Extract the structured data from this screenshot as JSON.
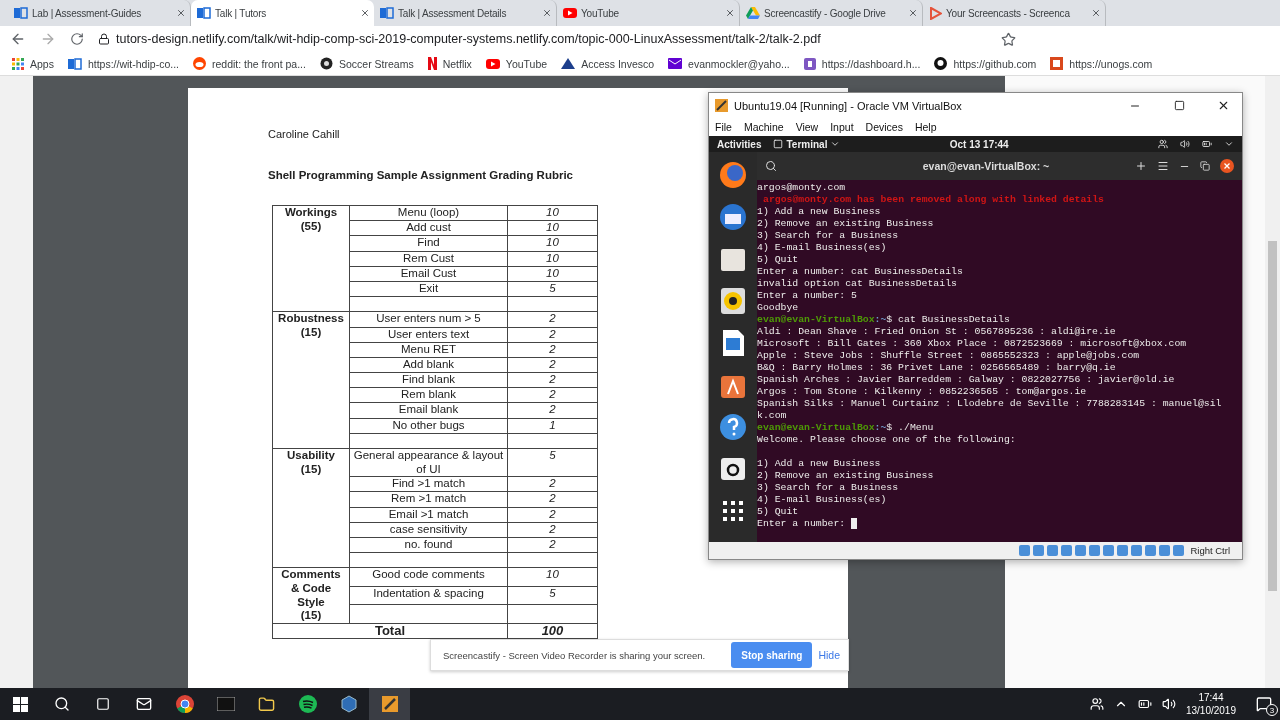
{
  "browser": {
    "tabs": [
      {
        "title": "Lab | Assessment-Guides",
        "kind": "tutors",
        "selected": false
      },
      {
        "title": "Talk | Tutors",
        "kind": "tutors",
        "selected": true
      },
      {
        "title": "Talk | Assessment Details",
        "kind": "tutors",
        "selected": false
      },
      {
        "title": "YouTube",
        "kind": "youtube",
        "selected": false
      },
      {
        "title": "Screencastify - Google Drive",
        "kind": "drive",
        "selected": false
      },
      {
        "title": "Your Screencasts - Screenca",
        "kind": "screencastify",
        "selected": false
      }
    ],
    "url": "tutors-design.netlify.com/talk/wit-hdip-comp-sci-2019-computer-systems.netlify.com/topic-000-LinuxAssessment/talk-2/talk-2.pdf",
    "bookmarks": [
      {
        "label": "Apps",
        "kind": "apps"
      },
      {
        "label": "https://wit-hdip-co...",
        "kind": "tutors"
      },
      {
        "label": "reddit: the front pa...",
        "kind": "reddit"
      },
      {
        "label": "Soccer Streams",
        "kind": "ball"
      },
      {
        "label": "Netflix",
        "kind": "netflix"
      },
      {
        "label": "YouTube",
        "kind": "youtube"
      },
      {
        "label": "Access Invesco",
        "kind": "invesco"
      },
      {
        "label": "evanmockler@yaho...",
        "kind": "mail"
      },
      {
        "label": "https://dashboard.h...",
        "kind": "dashboard"
      },
      {
        "label": "https://github.com",
        "kind": "github"
      },
      {
        "label": "https://unogs.com",
        "kind": "unogs"
      }
    ]
  },
  "document": {
    "author": "Caroline Cahill",
    "title": "Shell Programming Sample Assignment Grading Rubric",
    "groups": [
      {
        "category": [
          "Workings",
          "(55)"
        ],
        "rows": [
          {
            "criterion": "Menu (loop)",
            "marks": "10"
          },
          {
            "criterion": "Add cust",
            "marks": "10"
          },
          {
            "criterion": "Find",
            "marks": "10"
          },
          {
            "criterion": "Rem Cust",
            "marks": "10"
          },
          {
            "criterion": "Email Cust",
            "marks": "10"
          },
          {
            "criterion": "Exit",
            "marks": "5"
          }
        ]
      },
      {
        "category": [
          "Robustness",
          "(15)"
        ],
        "rows": [
          {
            "criterion": "User enters num > 5",
            "marks": "2"
          },
          {
            "criterion": "User enters text",
            "marks": "2"
          },
          {
            "criterion": "Menu RET",
            "marks": "2"
          },
          {
            "criterion": "Add blank",
            "marks": "2"
          },
          {
            "criterion": "Find blank",
            "marks": "2"
          },
          {
            "criterion": "Rem blank",
            "marks": "2"
          },
          {
            "criterion": "Email blank",
            "marks": "2"
          },
          {
            "criterion": "No other bugs",
            "marks": "1"
          }
        ]
      },
      {
        "category": [
          "Usability",
          "(15)"
        ],
        "rows": [
          {
            "criterion": "General appearance & layout of UI",
            "marks": "5"
          },
          {
            "criterion": "Find >1 match",
            "marks": "2"
          },
          {
            "criterion": "Rem >1 match",
            "marks": "2"
          },
          {
            "criterion": "Email >1 match",
            "marks": "2"
          },
          {
            "criterion": "case sensitivity",
            "marks": "2"
          },
          {
            "criterion": "no. found",
            "marks": "2"
          }
        ]
      },
      {
        "category": [
          "Comments",
          "& Code",
          "Style",
          "(15)"
        ],
        "rows": [
          {
            "criterion": "Good code comments",
            "marks": "10"
          },
          {
            "criterion": "Indentation & spacing",
            "marks": "5"
          }
        ]
      }
    ],
    "total": {
      "label": "Total",
      "marks": "100"
    }
  },
  "vm_window": {
    "title": "Ubuntu19.04 [Running] - Oracle VM VirtualBox",
    "menu": [
      "File",
      "Machine",
      "View",
      "Input",
      "Devices",
      "Help"
    ],
    "topbar": {
      "activities": "Activities",
      "app": "Terminal",
      "clock": "Oct 13  17:44"
    },
    "terminal_title": "evan@evan-VirtualBox: ~",
    "lines": [
      {
        "kind": "output",
        "text": "argos@monty.com"
      },
      {
        "kind": "error",
        "text": "argos@monty.com has been removed along with linked details"
      },
      {
        "kind": "output",
        "text": "1) Add a new Business"
      },
      {
        "kind": "output",
        "text": "2) Remove an existing Business"
      },
      {
        "kind": "output",
        "text": "3) Search for a Business"
      },
      {
        "kind": "output",
        "text": "4) E-mail Business(es)"
      },
      {
        "kind": "output",
        "text": "5) Quit"
      },
      {
        "kind": "output",
        "text": "Enter a number: cat BusinessDetails"
      },
      {
        "kind": "output",
        "text": "invalid option cat BusinessDetails"
      },
      {
        "kind": "output",
        "text": "Enter a number: 5"
      },
      {
        "kind": "output",
        "text": "Goodbye"
      },
      {
        "kind": "prompt",
        "user": "evan@evan-VirtualBox",
        "path": ":~",
        "command": "$ cat BusinessDetails"
      },
      {
        "kind": "output",
        "text": "Aldi : Dean Shave : Fried Onion St : 0567895236 : aldi@ire.ie"
      },
      {
        "kind": "output",
        "text": "Microsoft : Bill Gates : 360 Xbox Place : 0872523669 : microsoft@xbox.com"
      },
      {
        "kind": "output",
        "text": "Apple : Steve Jobs : Shuffle Street : 0865552323 : apple@jobs.com"
      },
      {
        "kind": "output",
        "text": "B&Q : Barry Holmes : 36 Privet Lane : 0256565489 : barry@q.ie"
      },
      {
        "kind": "output",
        "text": "Spanish Arches : Javier Barreddem : Galway : 0822027756 : javier@old.ie"
      },
      {
        "kind": "output",
        "text": "Argos : Tom Stone : Kilkenny : 0852236565 : tom@argos.ie"
      },
      {
        "kind": "output",
        "text": "Spanish Silks : Manuel Curtainz : Llodebre de Seville : 7788283145 : manuel@sil"
      },
      {
        "kind": "output",
        "text": "k.com"
      },
      {
        "kind": "prompt",
        "user": "evan@evan-VirtualBox",
        "path": ":~",
        "command": "$ ./Menu"
      },
      {
        "kind": "output",
        "text": "Welcome. Please choose one of the following:"
      },
      {
        "kind": "blank"
      },
      {
        "kind": "output",
        "text": "1) Add a new Business"
      },
      {
        "kind": "output",
        "text": "2) Remove an existing Business"
      },
      {
        "kind": "output",
        "text": "3) Search for a Business"
      },
      {
        "kind": "output",
        "text": "4) E-mail Business(es)"
      },
      {
        "kind": "output",
        "text": "5) Quit"
      },
      {
        "kind": "input",
        "text": "Enter a number:"
      }
    ],
    "host_key": "Right Ctrl"
  },
  "sharing_bar": {
    "message": "Screencastify - Screen Video Recorder is sharing your screen.",
    "stop": "Stop sharing",
    "hide": "Hide"
  },
  "taskbar": {
    "time": "17:44",
    "date": "13/10/2019",
    "notifications": "3"
  }
}
